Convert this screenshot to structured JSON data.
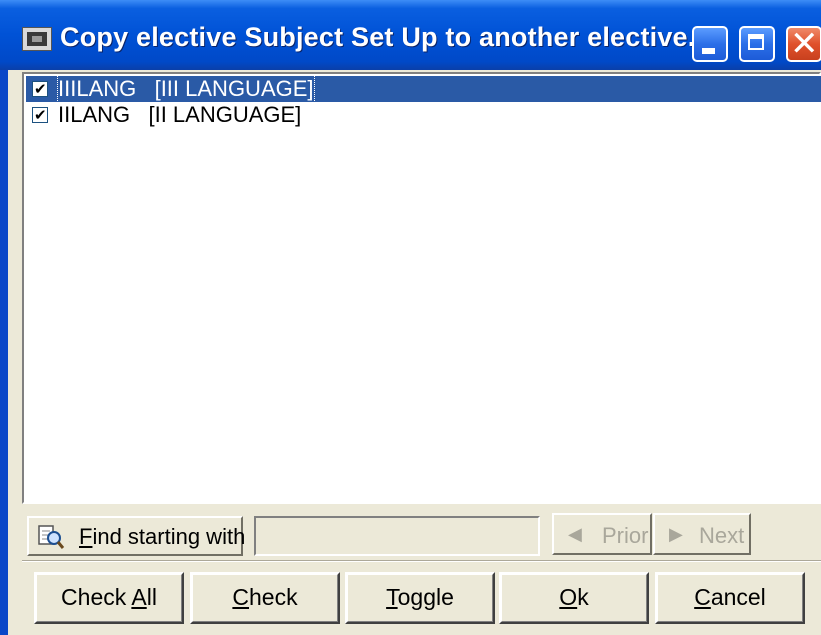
{
  "window": {
    "title": "Copy elective Subject Set Up to another elective...",
    "controls": {
      "minimize": "minimize-icon",
      "maximize": "maximize-icon",
      "close": "✕"
    }
  },
  "list": {
    "items": [
      {
        "label": "IIILANG   [III LANGUAGE]",
        "checked": true,
        "selected": true
      },
      {
        "label": "IILANG   [II LANGUAGE]",
        "checked": true,
        "selected": false
      }
    ]
  },
  "find": {
    "button_prefix": "",
    "button_accel": "F",
    "button_rest": "ind starting with",
    "icon": "find-magnifier-icon",
    "value": "",
    "prior_label": "Prior",
    "next_label": "Next",
    "prior_arrow": "◀",
    "next_arrow": "▶"
  },
  "buttons": {
    "check_all_pre": "Check ",
    "check_all_accel": "A",
    "check_all_post": "ll",
    "check_accel": "C",
    "check_post": "heck",
    "toggle_accel": "T",
    "toggle_post": "oggle",
    "ok_accel": "O",
    "ok_post": "k",
    "cancel_accel": "C",
    "cancel_post": "ancel"
  },
  "colors": {
    "titlebar": "#0052d6",
    "selection": "#2a5aa6",
    "face": "#ece9d8"
  }
}
